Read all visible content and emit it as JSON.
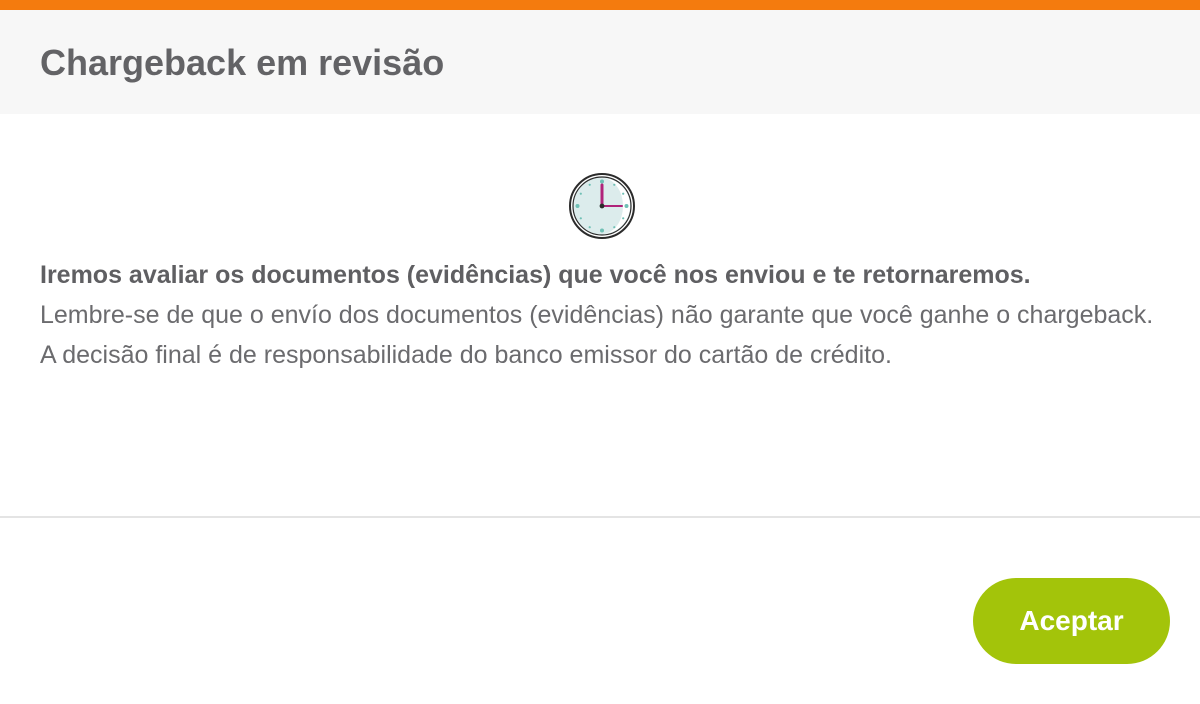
{
  "colors": {
    "accent_bar": "#f47b0e",
    "header_bg": "#f7f7f7",
    "title_text": "#636366",
    "body_text": "#6b6b6e",
    "button_bg": "#a3c40a",
    "button_text": "#ffffff",
    "clock_hands": "#b0237a",
    "clock_dots": "#6fc0b5"
  },
  "modal": {
    "title": "Chargeback em revisão",
    "icon": "clock-icon",
    "message_bold": "Iremos avaliar os documentos (evidências) que você nos enviou e te retornaremos.",
    "message_rest": "Lembre-se de que o envío dos documentos (evidências) não garante que você ganhe o chargeback. A decisão final é de responsabilidade do banco emissor do cartão de crédito.",
    "accept_label": "Aceptar"
  }
}
